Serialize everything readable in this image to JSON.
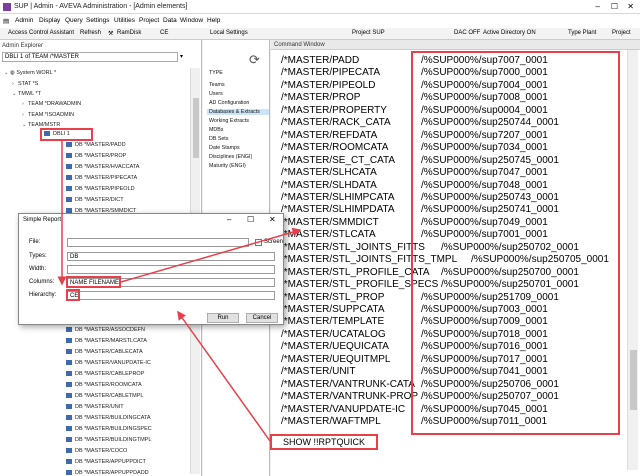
{
  "window": {
    "title": "SUP | Admin - AVEVA Administration - [Admin elements]"
  },
  "menu": [
    "Admin",
    "Display",
    "Query",
    "Settings",
    "Utilities",
    "Project",
    "Data",
    "Window",
    "Help"
  ],
  "toolbar": {
    "access_control": "Access Control Assistant",
    "refresh": "Refresh",
    "ramdisk": "RamDisk",
    "ce": "CE",
    "local_settings": "Local Settings",
    "project": "Project SUP",
    "dac": "DAC OFF",
    "active_directory": "Active Directory ON",
    "type_plant": "Type Plant",
    "project_short": "Project"
  },
  "explorer": {
    "title": "Admin Explorer",
    "selector": "DBLI 1 of TEAM /*MASTER",
    "tree": [
      "System WORL *",
      "STAT *S",
      "TMWL *T",
      "TEAM *DRAWADMIN",
      "TEAM *ISOADMIN",
      "TEAM/MSTR",
      "DBLI 1",
      "DB *MASTER/PADD",
      "DB *MASTER/PROP",
      "DB *MASTER/HVACCATA",
      "DB *MASTER/PIPECATA",
      "DB *MASTER/PIPEOLD",
      "DB *MASTER/DICT",
      "DB *MASTER/SMMDICT"
    ],
    "tree_lower": [
      "DB *MASTER/ASSOCDEFN",
      "DB *MASTER/MARSTLCATA",
      "DB *MASTER/CABLECATA",
      "DB *MASTER/VANUPDATE-IC",
      "DB *MASTER/CABLEPROP",
      "DB *MASTER/ROOMCATA",
      "DB *MASTER/CABLETMPL",
      "DB *MASTER/UNIT",
      "DB *MASTER/BUILDINGCATA",
      "DB *MASTER/BUILDINGSPEC",
      "DB *MASTER/BUILDINGTMPL",
      "DB *MASTER/COCO",
      "DB *MASTER/APPUPPDICT",
      "DB *MASTER/APPUPPDADD"
    ]
  },
  "middle_panel": {
    "items": [
      "TYPE",
      "Teams",
      "Users",
      "AD Configuration",
      "Databases & Extracts",
      "Working Extracts",
      "MDBs",
      "DB Sets",
      "Date Stamps",
      "Disciplines (ENGI)",
      "Maturity (ENGI)"
    ]
  },
  "command_window": {
    "title": "Command Window",
    "lines": [
      {
        "name": "/*MASTER/PADD",
        "value": "/%SUP000%/sup7007_0001"
      },
      {
        "name": "/*MASTER/PIPECATA",
        "value": "/%SUP000%/sup7000_0001"
      },
      {
        "name": "/*MASTER/PIPEOLD",
        "value": "/%SUP000%/sup7004_0001"
      },
      {
        "name": "/*MASTER/PROP",
        "value": "/%SUP000%/sup7008_0001"
      },
      {
        "name": "/*MASTER/PROPERTY",
        "value": "/%SUP000%/sup0004_0001"
      },
      {
        "name": "/*MASTER/RACK_CATA",
        "value": "/%SUP000%/sup250744_0001"
      },
      {
        "name": "/*MASTER/REFDATA",
        "value": "/%SUP000%/sup7207_0001"
      },
      {
        "name": "/*MASTER/ROOMCATA",
        "value": "/%SUP000%/sup7034_0001"
      },
      {
        "name": "/*MASTER/SE_CT_CATA",
        "value": "/%SUP000%/sup250745_0001"
      },
      {
        "name": "/*MASTER/SLHCATA",
        "value": "/%SUP000%/sup7047_0001"
      },
      {
        "name": "/*MASTER/SLHDATA",
        "value": "/%SUP000%/sup7048_0001"
      },
      {
        "name": "/*MASTER/SLHIMPCATA",
        "value": "/%SUP000%/sup250743_0001"
      },
      {
        "name": "/*MASTER/SLHIMPDATA",
        "value": "/%SUP000%/sup250741_0001"
      },
      {
        "name": "/*MASTER/SMMDICT",
        "value": "/%SUP000%/sup7049_0001"
      },
      {
        "name": "/*MASTER/STLCATA",
        "value": "/%SUP000%/sup7001_0001"
      },
      {
        "name": "/*MASTER/STL_JOINTS_FITTS",
        "value": "/%SUP000%/sup250702_0001"
      },
      {
        "name": "/*MASTER/STL_JOINTS_FITTS_TMPL",
        "value": "/%SUP000%/sup250705_0001"
      },
      {
        "name": "/*MASTER/STL_PROFILE_CATA",
        "value": "/%SUP000%/sup250700_0001"
      },
      {
        "name": "/*MASTER/STL_PROFILE_SPECS",
        "value": "/%SUP000%/sup250701_0001"
      },
      {
        "name": "/*MASTER/STL_PROP",
        "value": "/%SUP000%/sup251709_0001"
      },
      {
        "name": "/*MASTER/SUPPCATA",
        "value": "/%SUP000%/sup7003_0001"
      },
      {
        "name": "/*MASTER/TEMPLATE",
        "value": "/%SUP000%/sup7009_0001"
      },
      {
        "name": "/*MASTER/UCATALOG",
        "value": "/%SUP000%/sup7018_0001"
      },
      {
        "name": "/*MASTER/UEQUICATA",
        "value": "/%SUP000%/sup7016_0001"
      },
      {
        "name": "/*MASTER/UEQUITMPL",
        "value": "/%SUP000%/sup7017_0001"
      },
      {
        "name": "/*MASTER/UNIT",
        "value": "/%SUP000%/sup7041_0001"
      },
      {
        "name": "/*MASTER/VANTRUNK-CATA",
        "value": "/%SUP000%/sup250706_0001"
      },
      {
        "name": "/*MASTER/VANTRUNK-PROP",
        "value": "/%SUP000%/sup250707_0001"
      },
      {
        "name": "/*MASTER/VANUPDATE-IC",
        "value": "/%SUP000%/sup7045_0001"
      },
      {
        "name": "/*MASTER/WAFTMPL",
        "value": "/%SUP000%/sup7011_0001"
      }
    ],
    "show_command": "SHOW !!RPTQUICK"
  },
  "dialog": {
    "title": "Simple Report",
    "file_label": "File:",
    "file_value": "",
    "screen_label": "Screen",
    "types_label": "Types:",
    "types_value": "DB",
    "width_label": "Width:",
    "width_value": "",
    "columns_label": "Columns:",
    "columns_value": "NAME FILENAME",
    "hierarchy_label": "Hierarchy:",
    "hierarchy_value": "CE",
    "run_label": "Run",
    "cancel_label": "Cancel",
    "minimize": "–",
    "maximize": "☐",
    "close": "✕"
  },
  "colors": {
    "annotation": "#e8404a",
    "app_icon": "#7a3f9d",
    "db_icon": "#3e6bb0"
  }
}
